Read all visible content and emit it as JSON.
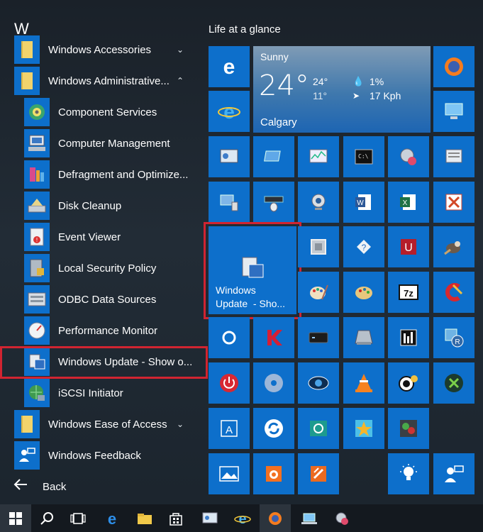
{
  "start_menu": {
    "section_letter": "W",
    "items": [
      {
        "label": "Windows Accessories",
        "icon": "folder-icon",
        "chevron": "⌄",
        "expanded": false
      },
      {
        "label": "Windows Administrative...",
        "icon": "folder-icon",
        "chevron": "⌃",
        "expanded": true
      },
      {
        "label": "Component Services",
        "icon": "component-services-icon"
      },
      {
        "label": "Computer Management",
        "icon": "computer-management-icon"
      },
      {
        "label": "Defragment and Optimize...",
        "icon": "defragment-icon"
      },
      {
        "label": "Disk Cleanup",
        "icon": "disk-cleanup-icon"
      },
      {
        "label": "Event Viewer",
        "icon": "event-viewer-icon"
      },
      {
        "label": "Local Security Policy",
        "icon": "local-security-policy-icon"
      },
      {
        "label": "ODBC Data Sources",
        "icon": "odbc-icon"
      },
      {
        "label": "Performance Monitor",
        "icon": "performance-monitor-icon"
      },
      {
        "label": "Windows Update  - Show o...",
        "icon": "windows-update-icon"
      },
      {
        "label": "iSCSI Initiator",
        "icon": "iscsi-icon"
      },
      {
        "label": "Windows Ease of Access",
        "icon": "folder-icon",
        "chevron": "⌄",
        "expanded": false
      },
      {
        "label": "Windows Feedback",
        "icon": "feedback-icon"
      }
    ],
    "back_label": "Back"
  },
  "tiles": {
    "group_title": "Life at a glance",
    "weather": {
      "condition": "Sunny",
      "temperature": "24°",
      "high": "24°",
      "low": "11°",
      "humidity": "1%",
      "wind": "17 Kph",
      "city": "Calgary"
    },
    "windows_update_tile": {
      "line1": "Windows",
      "line2": "Update  - Sho..."
    }
  },
  "colors": {
    "tile_blue": "#0d6fcb",
    "highlight_red": "#d12431",
    "background": "#1c2630",
    "taskbar": "#14191f"
  }
}
